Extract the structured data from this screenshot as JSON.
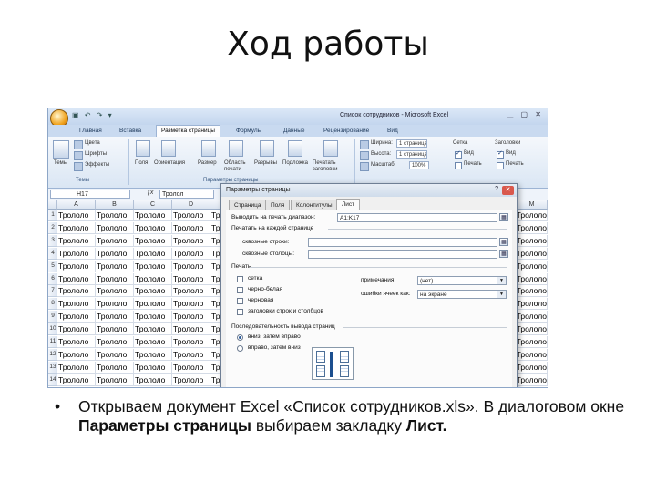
{
  "slide": {
    "title": "Ход работы",
    "bullet": {
      "marker": "•",
      "part1": "Открываем документ Excel «Список сотрудников.xls». В диалоговом окне ",
      "bold1": "Параметры страницы",
      "part2": " выбираем закладку ",
      "bold2": "Лист."
    }
  },
  "excel": {
    "window_title": "Список сотрудников - Microsoft Excel",
    "qat": "▣ ↶ ↷ ▾",
    "win_controls": "▁ ▢ ✕",
    "tabs": [
      "Главная",
      "Вставка",
      "Разметка страницы",
      "Формулы",
      "Данные",
      "Рецензирование",
      "Вид"
    ],
    "active_tab": "Разметка страницы",
    "ribbon": {
      "themes_buttons": [
        "Цвета",
        "Шрифты",
        "Эффекты"
      ],
      "themes_main": "Темы",
      "themes_group": "Темы",
      "page_setup_buttons": [
        "Поля",
        "Ориентация",
        "Размер",
        "Область печати",
        "Разрывы",
        "Подложка",
        "Печатать заголовки"
      ],
      "page_setup_group": "Параметры страницы",
      "fit": {
        "width_label": "Ширина:",
        "width_value": "1 страница",
        "height_label": "Высота:",
        "height_value": "1 страница",
        "scale_label": "Масштаб:",
        "scale_value": "100%"
      },
      "sheet_opts": {
        "grid_label": "Сетка",
        "headings_label": "Заголовки",
        "view": "Вид",
        "print": "Печать"
      }
    },
    "name_box": "H17",
    "formula_value": "Тролол",
    "columns": [
      "A",
      "B",
      "C",
      "D",
      "M"
    ],
    "rows": [
      "1",
      "2",
      "3",
      "4",
      "5",
      "6",
      "7",
      "8",
      "9",
      "10",
      "11",
      "12",
      "13",
      "14"
    ],
    "cell_text": "Трололо",
    "dialog": {
      "title": "Параметры страницы",
      "help": "?",
      "close": "✕",
      "tabs": [
        "Страница",
        "Поля",
        "Колонтитулы",
        "Лист"
      ],
      "active_tab": "Лист",
      "print_area_label": "Выводить на печать диапазон:",
      "print_area_value": "A1:K17",
      "print_titles_label": "Печатать на каждой странице",
      "rows_label": "сквозные строки:",
      "cols_label": "сквозные столбцы:",
      "print_section": "Печать",
      "checks": [
        "сетка",
        "черно-белая",
        "черновая",
        "заголовки строк и столбцов"
      ],
      "comments_label": "примечания:",
      "comments_value": "(нет)",
      "errors_label": "ошибки ячеек как:",
      "errors_value": "на экране",
      "order_section": "Последовательность вывода страниц",
      "order_options": [
        "вниз, затем вправо",
        "вправо, затем вниз"
      ],
      "picker_glyph": "▦"
    }
  }
}
